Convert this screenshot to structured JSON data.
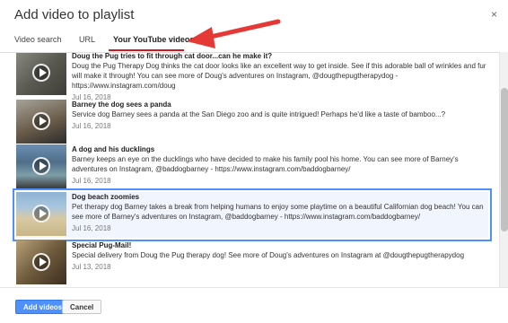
{
  "dialog": {
    "title": "Add video to playlist",
    "close_glyph": "×"
  },
  "tabs": [
    {
      "label": "Video search"
    },
    {
      "label": "URL"
    },
    {
      "label": "Your YouTube videos"
    }
  ],
  "colors": {
    "accent": "#4d90fe",
    "tab_underline": "#cc181e",
    "arrow": "#e53935"
  },
  "videos": [
    {
      "title": "Doug the Pug tries to fit through cat door...can he make it?",
      "description": "Doug the Pug Therapy Dog thinks the cat door looks like an excellent way to get inside. See if this adorable ball of wrinkles and fur will make it through! You can see more of Doug's adventures on Instagram, @dougthepugtherapydog - https://www.instagram.com/doug",
      "date": "Jul 16, 2018"
    },
    {
      "title": "Barney the dog sees a panda",
      "description": "Service dog Barney sees a panda at the San Diego zoo and is quite intrigued! Perhaps he'd like a taste of bamboo...?",
      "date": "Jul 16, 2018"
    },
    {
      "title": "A dog and his ducklings",
      "description": "Barney keeps an eye on the ducklings who have decided to make his family pool his home. You can see more of Barney's adventures on Instagram, @baddogbarney - https://www.instagram.com/baddogbarney/",
      "date": "Jul 16, 2018"
    },
    {
      "title": "Dog beach zoomies",
      "description": "Pet therapy dog Barney takes a break from helping humans to enjoy some playtime on a beautiful Californian dog beach! You can see more of Barney's adventures on Instagram, @baddogbarney - https://www.instagram.com/baddogbarney/",
      "date": "Jul 16, 2018"
    },
    {
      "title": "Special Pug-Mail!",
      "description": "Special delivery from Doug the Pug therapy dog! See more of Doug's adventures on Instagram at @dougthepugtherapydog",
      "date": "Jul 13, 2018"
    }
  ],
  "footer": {
    "add_label": "Add videos",
    "cancel_label": "Cancel"
  }
}
